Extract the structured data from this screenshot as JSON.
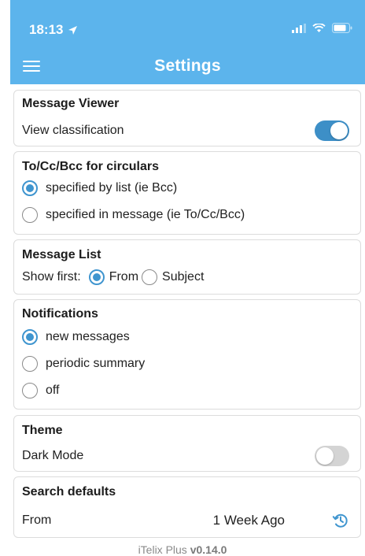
{
  "status_bar": {
    "time": "18:13"
  },
  "header": {
    "title": "Settings"
  },
  "message_viewer": {
    "heading": "Message Viewer",
    "view_classification_label": "View classification",
    "view_classification_on": true
  },
  "circulars": {
    "heading": "To/Cc/Bcc for circulars",
    "options": [
      "specified by list (ie Bcc)",
      "specified in message (ie To/Cc/Bcc)"
    ],
    "selected": "specified by list (ie Bcc)"
  },
  "message_list": {
    "heading": "Message List",
    "show_first_label": "Show first:",
    "options": [
      "From",
      "Subject"
    ],
    "selected": "From"
  },
  "notifications": {
    "heading": "Notifications",
    "options": [
      "new messages",
      "periodic summary",
      "off"
    ],
    "selected": "new messages"
  },
  "theme": {
    "heading": "Theme",
    "dark_mode_label": "Dark Mode",
    "dark_mode_on": false
  },
  "search_defaults": {
    "heading": "Search defaults",
    "from_label": "From",
    "from_value": "1 Week Ago"
  },
  "footer": {
    "app_name": "iTelix Plus",
    "version": "v0.14.0"
  },
  "colors": {
    "header_bg": "#5cb4ec",
    "accent": "#3f95cf",
    "toggle_off": "#d4d4d4"
  },
  "icons": {
    "location": "location-arrow-icon",
    "menu": "hamburger-menu-icon",
    "history": "history-icon"
  }
}
